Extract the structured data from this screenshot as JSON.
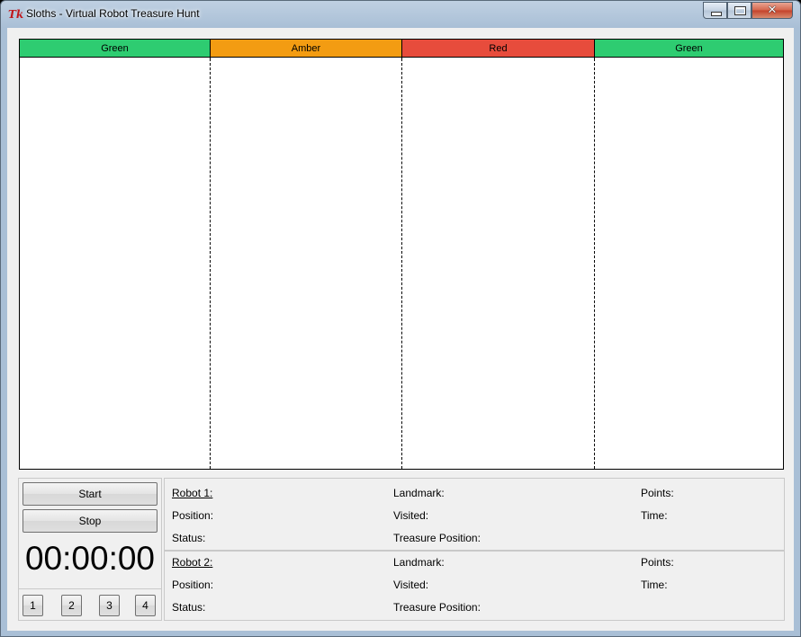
{
  "window": {
    "title": "Sloths - Virtual Robot Treasure Hunt",
    "icon": "tk-feather-icon",
    "controls": {
      "minimize": "minimize-icon",
      "maximize": "maximize-icon",
      "close": "✕"
    }
  },
  "zones": [
    {
      "label": "Green",
      "color": "#2ecc71"
    },
    {
      "label": "Amber",
      "color": "#f39c12"
    },
    {
      "label": "Red",
      "color": "#e74c3c"
    },
    {
      "label": "Green",
      "color": "#2ecc71"
    }
  ],
  "controls": {
    "start_label": "Start",
    "stop_label": "Stop",
    "timer": "00:00:00",
    "robot_buttons": [
      "1",
      "2",
      "3",
      "4"
    ]
  },
  "robots": [
    {
      "name": "Robot 1:",
      "landmark_label": "Landmark:",
      "points_label": "Points:",
      "position_label": "Position:",
      "visited_label": "Visited:",
      "time_label": "Time:",
      "status_label": "Status:",
      "treasure_label": "Treasure Position:"
    },
    {
      "name": "Robot 2:",
      "landmark_label": "Landmark:",
      "points_label": "Points:",
      "position_label": "Position:",
      "visited_label": "Visited:",
      "time_label": "Time:",
      "status_label": "Status:",
      "treasure_label": "Treasure Position:"
    }
  ]
}
